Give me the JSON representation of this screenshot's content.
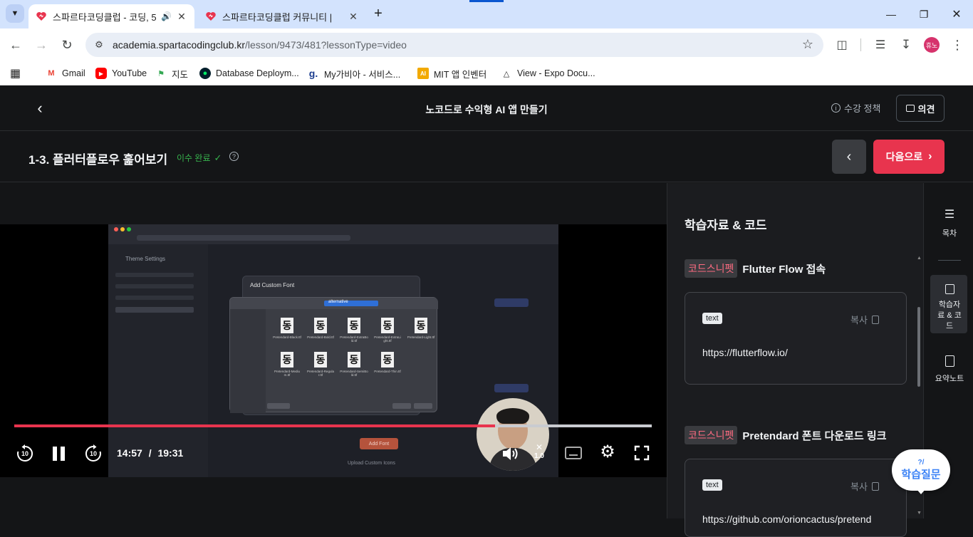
{
  "browser": {
    "tabs": [
      {
        "title": "스파르타코딩클럽 - 코딩, 5",
        "active": true
      },
      {
        "title": "스파르타코딩클럽 커뮤니티 | ",
        "active": false
      }
    ],
    "url_host": "academia.spartacodingclub.kr",
    "url_path": "/lesson/9473/481?lessonType=video",
    "profile_label": "휴노",
    "bookmarks": [
      {
        "label": "Gmail",
        "icon": "gmail-icon"
      },
      {
        "label": "YouTube",
        "icon": "youtube-icon"
      },
      {
        "label": "지도",
        "icon": "maps-icon"
      },
      {
        "label": "Database Deploym...",
        "icon": "mongodb-icon"
      },
      {
        "label": "My가비아 - 서비스...",
        "icon": "gabia-icon"
      },
      {
        "label": "MIT 앱 인벤터",
        "icon": "mit-icon"
      },
      {
        "label": "View - Expo Docu...",
        "icon": "expo-icon"
      }
    ]
  },
  "header": {
    "course_title": "노코드로 수익형 AI 앱 만들기",
    "policy_label": "수강 정책",
    "feedback_label": "의견"
  },
  "lesson": {
    "title": "1-3. 플러터플로우 훑어보기",
    "status": "이수 완료",
    "next_label": "다음으로"
  },
  "player": {
    "current_time": "14:57",
    "separator": "/",
    "total_time": "19:31",
    "progress": 0.754,
    "speed": "1.0",
    "skip_back": "10",
    "skip_forward": "10"
  },
  "video_content": {
    "window_title": "Add Custom Font",
    "theme_settings": "Theme Settings",
    "folder": "alternative",
    "fonts": [
      "Pretendard-Black.ttf",
      "Pretendard-Bold.ttf",
      "Pretendard-ExtraBold.ttf",
      "Pretendard-ExtraLight.ttf",
      "Pretendard-Light.ttf",
      "Pretendard-Medium.ttf",
      "Pretendard-Regular.ttf",
      "Pretendard-SemiBold.ttf",
      "Pretendard-Thin.ttf"
    ],
    "glyph": "동",
    "add_font": "Add Font",
    "upload_fonts": "Upload Custom Icons"
  },
  "materials": {
    "heading": "학습자료 & 코드",
    "snippets": [
      {
        "tag": "코드스니펫",
        "title": "Flutter Flow 접속",
        "lang": "text",
        "copy": "복사",
        "code": "https://flutterflow.io/"
      },
      {
        "tag": "코드스니펫",
        "title": "Pretendard 폰트 다운로드 링크",
        "lang": "text",
        "copy": "복사",
        "code": "https://github.com/orioncactus/pretend"
      }
    ]
  },
  "side_nav": {
    "toc": "목차",
    "materials": "학습자료 & 코드",
    "summary": "요약노트"
  },
  "ask_bubble": {
    "label": "학습질문"
  },
  "colors": {
    "accent": "#e8344e",
    "status_green": "#37b24d",
    "bg": "#141517"
  }
}
